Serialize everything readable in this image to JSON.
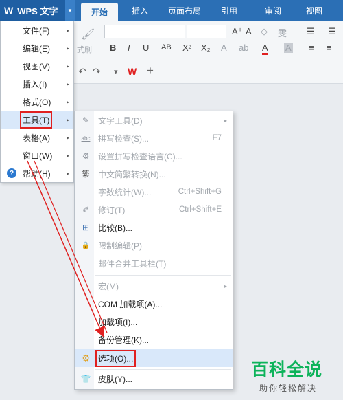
{
  "app": {
    "logo": "W",
    "title": "WPS 文字",
    "dropdown_glyph": "▾"
  },
  "tabs": [
    "开始",
    "插入",
    "页面布局",
    "引用",
    "审阅",
    "视图"
  ],
  "ribbon": {
    "format_painter_label": "式刷",
    "glyphs": [
      "A⁺",
      "A⁻",
      "◇",
      "雯",
      "☰",
      "☰",
      "B",
      "I",
      "U",
      "AB",
      "X²",
      "X₂",
      "A",
      "ab",
      "A",
      "A",
      "≡",
      "≡"
    ],
    "quick_access": [
      "↶",
      "↷",
      "▾",
      "W",
      "+"
    ]
  },
  "main_menu": [
    {
      "label": "文件(F)",
      "arrow": "▸"
    },
    {
      "label": "编辑(E)",
      "arrow": "▸"
    },
    {
      "label": "视图(V)",
      "arrow": "▸"
    },
    {
      "label": "插入(I)",
      "arrow": "▸"
    },
    {
      "label": "格式(O)",
      "arrow": "▸"
    },
    {
      "label": "工具(T)",
      "arrow": "▸",
      "highlighted": true
    },
    {
      "label": "表格(A)",
      "arrow": "▸"
    },
    {
      "label": "窗口(W)",
      "arrow": "▸"
    },
    {
      "label": "帮助(H)",
      "arrow": "▸",
      "icon": "help-icon",
      "icon_glyph": "?"
    }
  ],
  "tools_submenu": [
    {
      "label": "文字工具(D)",
      "icon": "text-tools-icon",
      "glyph": "✎",
      "disabled": true,
      "submenu": true
    },
    {
      "label": "拼写检查(S)...",
      "icon": "spellcheck-icon",
      "glyph": "abc",
      "disabled": true,
      "shortcut": "F7"
    },
    {
      "label": "设置拼写检查语言(C)...",
      "icon": "language-icon",
      "glyph": "⚙",
      "disabled": true
    },
    {
      "label": "中文简繁转换(N)...",
      "icon": "convert-icon",
      "glyph": "繁",
      "disabled": true
    },
    {
      "label": "字数统计(W)...",
      "disabled": true,
      "shortcut": "Ctrl+Shift+G"
    },
    {
      "label": "修订(T)",
      "icon": "revision-icon",
      "glyph": "✐",
      "disabled": true,
      "shortcut": "Ctrl+Shift+E"
    },
    {
      "label": "比较(B)...",
      "icon": "compare-icon",
      "glyph": "⊞",
      "disabled": false
    },
    {
      "label": "限制编辑(P)",
      "icon": "restrict-edit-icon",
      "glyph": "🔒",
      "disabled": true
    },
    {
      "label": "邮件合并工具栏(T)",
      "disabled": true
    },
    {
      "label": "宏(M)",
      "disabled": true,
      "submenu": true
    },
    {
      "label": "COM 加载项(A)...",
      "disabled": false
    },
    {
      "label": "加载项(I)...",
      "disabled": false
    },
    {
      "label": "备份管理(K)...",
      "disabled": false
    },
    {
      "label": "选项(O)...",
      "icon": "options-gear-icon",
      "glyph": "⚙",
      "disabled": false,
      "highlighted": true
    },
    {
      "label": "皮肤(Y)...",
      "icon": "skin-icon",
      "glyph": "👕",
      "disabled": false
    }
  ],
  "watermark": {
    "title": "百科全说",
    "subtitle": "助你轻松解决"
  },
  "colors": {
    "accent": "#2b6fb5",
    "highlight": "#d9e8fa",
    "annotation_red": "#e02020",
    "watermark_green": "#0db35a"
  }
}
